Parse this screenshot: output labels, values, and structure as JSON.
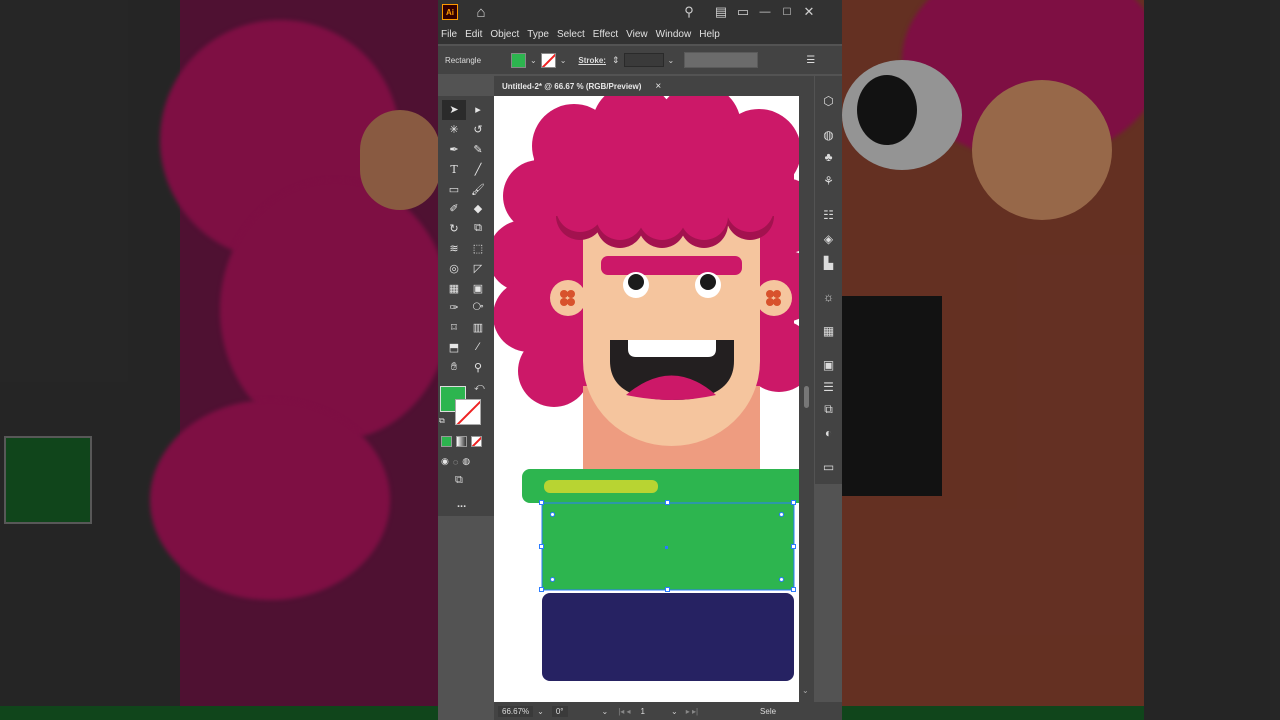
{
  "app": {
    "logo": "Ai",
    "title_icons": [
      "home-icon",
      "search-icon",
      "arrange-icon",
      "workspace-icon"
    ]
  },
  "menu": [
    "File",
    "Edit",
    "Object",
    "Type",
    "Select",
    "Effect",
    "View",
    "Window",
    "Help"
  ],
  "control_bar": {
    "object_type": "Rectangle",
    "fill_color": "#2DB54F",
    "stroke_label": "Stroke:"
  },
  "document_tab": {
    "title": "Untitled-2* @ 66.67 % (RGB/Preview)",
    "close": "×"
  },
  "status_bar": {
    "zoom": "66.67%",
    "rotation": "0°",
    "artboard_number": "1",
    "selection_label": "Sele"
  },
  "tools_panel": {
    "more": "..."
  },
  "colors": {
    "fill": "#2DB54F",
    "hair": "#CC1868",
    "hair_dark": "#A3124F",
    "skin": "#F5C59E",
    "neck": "#EE9C80",
    "shirt_green": "#2DB54F",
    "navy": "#262262"
  }
}
